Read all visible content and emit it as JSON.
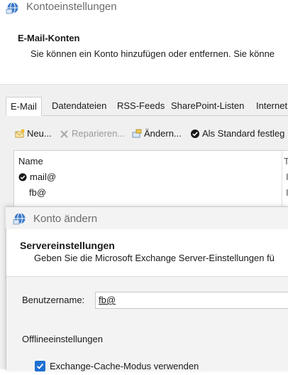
{
  "window": {
    "title": "Kontoeinstellungen"
  },
  "header": {
    "title": "E-Mail-Konten",
    "description": "Sie können ein Konto hinzufügen oder entfernen. Sie könne"
  },
  "tabs": [
    {
      "label": "E-Mail"
    },
    {
      "label": "Datendateien"
    },
    {
      "label": "RSS-Feeds"
    },
    {
      "label": "SharePoint-Listen"
    },
    {
      "label": "Internet"
    }
  ],
  "toolbar": {
    "new_label": "Neu...",
    "repair_label": "Reparieren...",
    "change_label": "Ändern...",
    "default_label": "Als Standard festleg"
  },
  "accounts": {
    "column_name": "Name",
    "rows": [
      {
        "name": "mail@",
        "default": true
      },
      {
        "name": "fb@",
        "default": false
      }
    ]
  },
  "dialog": {
    "title": "Konto ändern",
    "section_title": "Servereinstellungen",
    "section_desc": "Geben Sie die Microsoft Exchange Server-Einstellungen fü",
    "username_label": "Benutzername:",
    "username_value": "fb@",
    "offline_label": "Offlineeinstellungen",
    "cache_mode_label": "Exchange-Cache-Modus verwenden"
  }
}
